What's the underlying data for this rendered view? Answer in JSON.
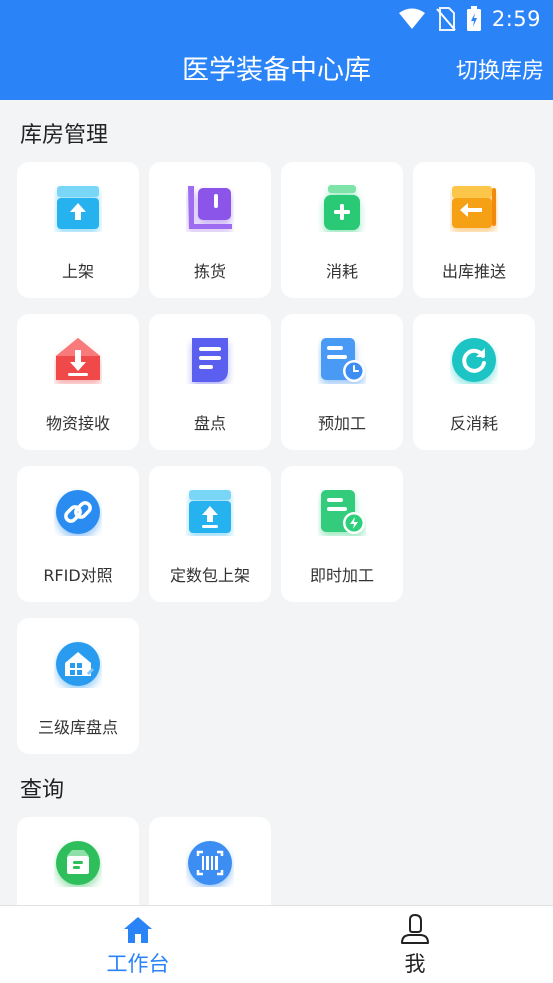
{
  "status_bar": {
    "time": "2:59"
  },
  "header": {
    "title": "医学装备中心库",
    "switch_label": "切换库房"
  },
  "sections": {
    "warehouse": {
      "title": "库房管理",
      "items": [
        {
          "label": "上架",
          "icon": "shelf-up-icon",
          "color": "#2ab8f0"
        },
        {
          "label": "拣货",
          "icon": "picking-cart-icon",
          "color": "#8a55e8"
        },
        {
          "label": "消耗",
          "icon": "consume-bottle-icon",
          "color": "#2fcf7a"
        },
        {
          "label": "出库推送",
          "icon": "outbound-push-icon",
          "color": "#f7a21a"
        },
        {
          "label": "物资接收",
          "icon": "receive-icon",
          "color": "#f24f4f"
        },
        {
          "label": "盘点",
          "icon": "inventory-doc-icon",
          "color": "#5a5ff0"
        },
        {
          "label": "预加工",
          "icon": "preprocess-icon",
          "color": "#3d8ef2"
        },
        {
          "label": "反消耗",
          "icon": "reverse-consume-icon",
          "color": "#1ec7c7"
        },
        {
          "label": "RFID对照",
          "icon": "rfid-link-icon",
          "color": "#2a8cf0"
        },
        {
          "label": "定数包上架",
          "icon": "package-shelf-icon",
          "color": "#2ab8f0"
        },
        {
          "label": "即时加工",
          "icon": "instant-process-icon",
          "color": "#2fcf7a"
        },
        {
          "label": "三级库盘点",
          "icon": "level3-inventory-icon",
          "color": "#2a9cf0"
        }
      ]
    },
    "query": {
      "title": "查询",
      "items": [
        {
          "label": "",
          "icon": "query-box-icon",
          "color": "#2fbf5c"
        },
        {
          "label": "",
          "icon": "barcode-scan-icon",
          "color": "#3d8ef2"
        }
      ]
    }
  },
  "bottom_nav": {
    "items": [
      {
        "label": "工作台",
        "icon": "home-icon",
        "color": "#2a84f7"
      },
      {
        "label": "我",
        "icon": "user-icon",
        "color": "#222222"
      }
    ]
  }
}
